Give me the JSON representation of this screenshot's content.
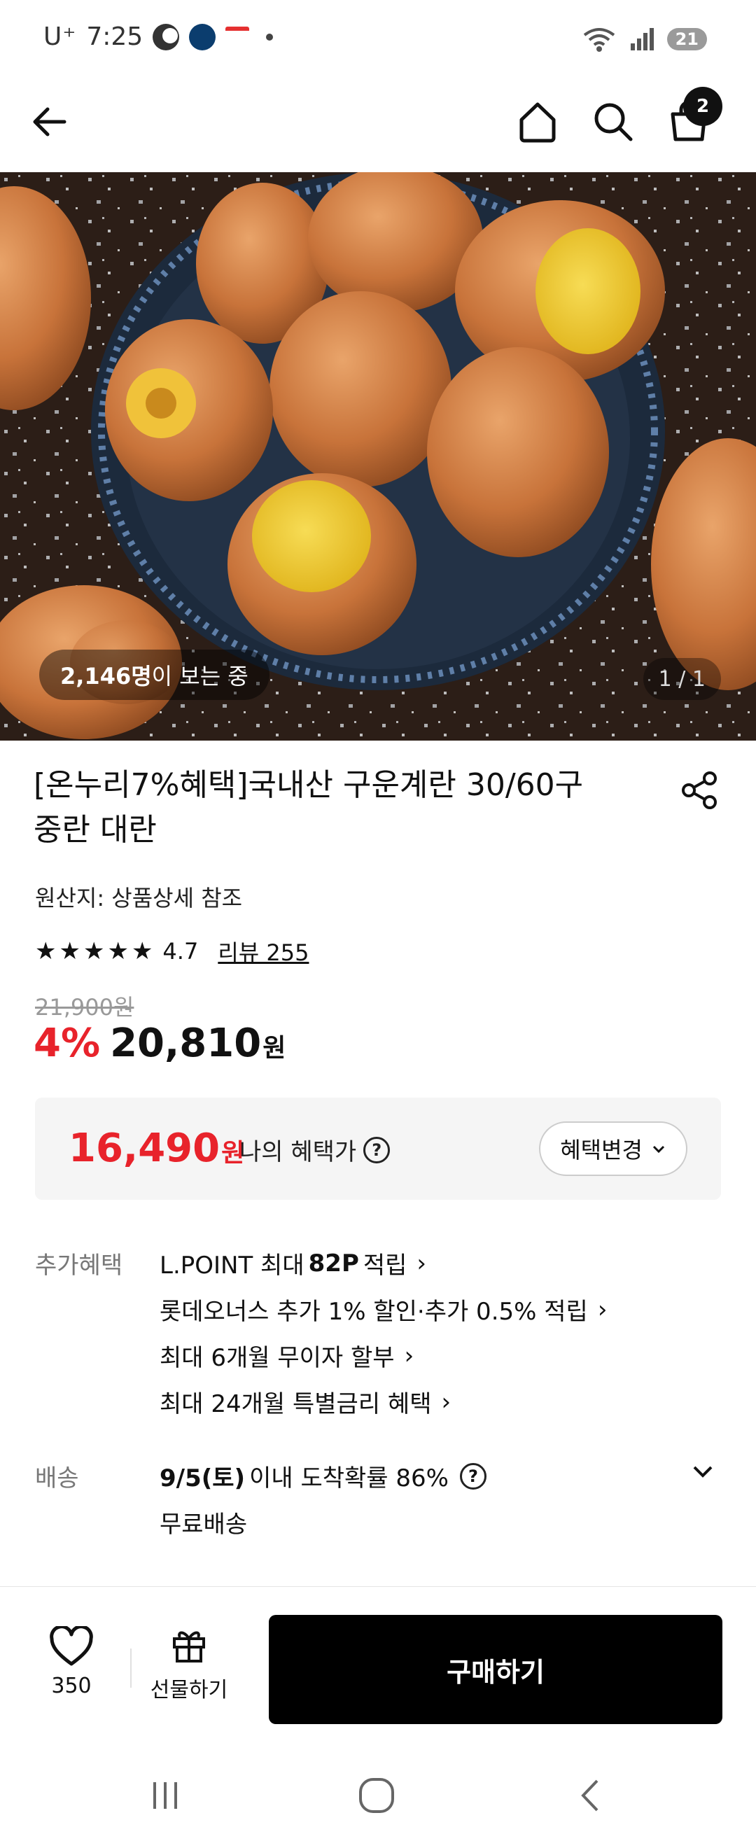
{
  "status_bar": {
    "carrier": "U⁺",
    "time": "7:25",
    "battery": "21"
  },
  "header": {
    "cart_count": "2"
  },
  "hero": {
    "viewers_count": "2,146명",
    "viewers_suffix": "이 보는 중",
    "page_counter": "1 / 1"
  },
  "product": {
    "title_line1": "[온누리7%혜택]국내산 구운계란 30/60구",
    "title_line2": "중란 대란",
    "origin": "원산지: 상품상세 참조",
    "rating_value": "4.7",
    "rating_stars": 4.7,
    "review_label": "리뷰 255",
    "original_price": "21,900원",
    "discount": "4%",
    "price": "20,810",
    "price_unit": "원"
  },
  "benefit_box": {
    "price": "16,490",
    "price_unit": "원",
    "label": "나의 혜택가",
    "change_button": "혜택변경"
  },
  "extra_benefits": {
    "label": "추가혜택",
    "line1_pre": "L.POINT 최대 ",
    "line1_bold": "82P",
    "line1_post": " 적립",
    "line2": "롯데오너스 추가 1% 할인·추가 0.5% 적립",
    "line3": "최대 6개월 무이자 할부",
    "line4": "최대 24개월 특별금리 혜택"
  },
  "shipping": {
    "label": "배송",
    "date": "9/5(토)",
    "probability": " 이내 도착확률 86%",
    "free": "무료배송"
  },
  "bottom_bar": {
    "like_count": "350",
    "gift_label": "선물하기",
    "buy_label": "구매하기"
  },
  "colors": {
    "accent_red": "#e8232b",
    "buy_button": "#000000"
  }
}
